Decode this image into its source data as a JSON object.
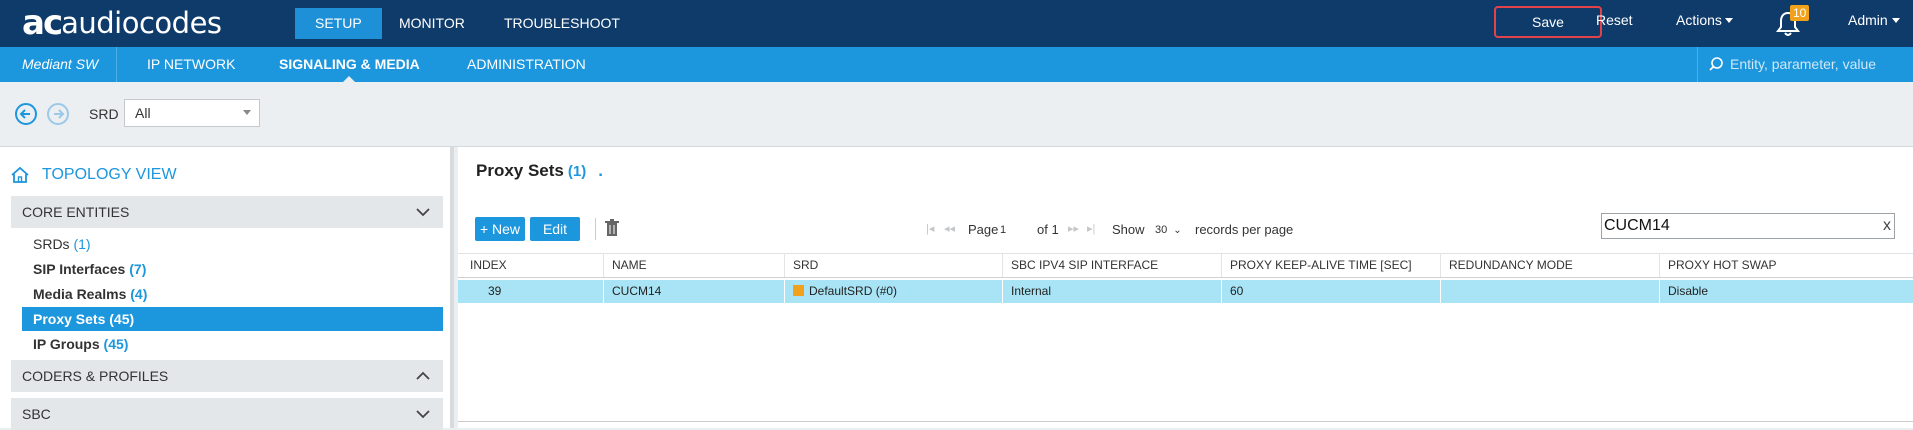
{
  "header": {
    "logo_text": "audiocodes",
    "nav": [
      "SETUP",
      "MONITOR",
      "TROUBLESHOOT"
    ],
    "active_nav": "SETUP",
    "save_label": "Save",
    "reset_label": "Reset",
    "actions_label": "Actions",
    "notification_count": "10",
    "user_label": "Admin"
  },
  "subnav": {
    "product": "Mediant SW",
    "items": [
      "IP NETWORK",
      "SIGNALING & MEDIA",
      "ADMINISTRATION"
    ],
    "active": "SIGNALING & MEDIA",
    "search_placeholder": "Entity, parameter, value"
  },
  "filter": {
    "srd_label": "SRD",
    "srd_value": "All"
  },
  "sidebar": {
    "topology_label": "TOPOLOGY VIEW",
    "sections": [
      {
        "label": "CORE ENTITIES",
        "expanded": true
      },
      {
        "label": "CODERS & PROFILES",
        "expanded": false
      },
      {
        "label": "SBC",
        "expanded": true
      }
    ],
    "items": [
      {
        "label": "SRDs",
        "count": "(1)"
      },
      {
        "label": "SIP Interfaces",
        "count": "(7)"
      },
      {
        "label": "Media Realms",
        "count": "(4)"
      },
      {
        "label": "Proxy Sets",
        "count": "(45)"
      },
      {
        "label": "IP Groups",
        "count": "(45)"
      }
    ],
    "selected_item": "Proxy Sets"
  },
  "main": {
    "title": "Proxy Sets",
    "count": "(1)",
    "dot": ".",
    "new_label": "+ New",
    "edit_label": "Edit",
    "pager": {
      "page_label": "Page",
      "page_value": "1",
      "of_label": "of 1",
      "show_label": "Show",
      "show_value": "30",
      "per_page_label": "records per page"
    },
    "search_value": "CUCM14",
    "search_clear": "x",
    "columns": [
      "INDEX",
      "NAME",
      "SRD",
      "SBC IPV4 SIP INTERFACE",
      "PROXY KEEP-ALIVE TIME [SEC]",
      "REDUNDANCY MODE",
      "PROXY HOT SWAP"
    ],
    "rows": [
      {
        "index": "39",
        "name": "CUCM14",
        "srd": "DefaultSRD (#0)",
        "sip_interface": "Internal",
        "keep_alive": "60",
        "redundancy": "",
        "hot_swap": "Disable"
      }
    ]
  },
  "colors": {
    "topbar": "#0f3b6b",
    "accent": "#1c96dd",
    "selected_row": "#a8e4f5",
    "save_border": "#e2424a",
    "badge": "#f1a21a",
    "srd_swatch": "#f2a11d"
  }
}
